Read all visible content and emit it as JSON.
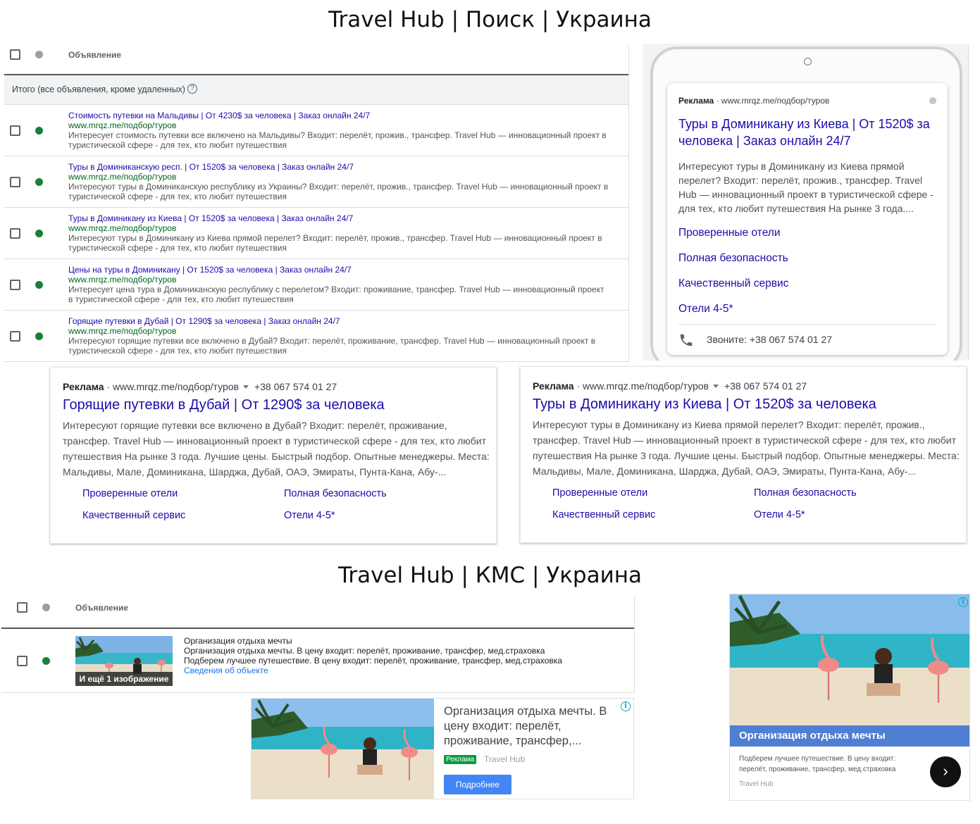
{
  "search_title": "Travel Hub | Поиск | Украина",
  "kms_title": "Travel Hub | КМС | Украина",
  "search_table": {
    "column_header": "Объявление",
    "total_label": "Итого (все объявления, кроме удаленных)",
    "help_glyph": "?",
    "rows": [
      {
        "headline": "Стоимость путевки на Мальдивы | От 4230$ за человека | Заказ онлайн 24/7",
        "url": "www.mrqz.me/подбор/туров",
        "description": "Интересует стоимость путевки все включено на Мальдивы? Входит: перелёт, прожив., трансфер. Travel Hub — инновационный проект в туристической сфере - для тех, кто любит путешествия"
      },
      {
        "headline": "Туры в Доминиканскую респ. | От 1520$ за человека | Заказ онлайн 24/7",
        "url": "www.mrqz.me/подбор/туров",
        "description": "Интересуют туры в Доминиканскую республику из Украины? Входит: перелёт, прожив., трансфер. Travel Hub — инновационный проект в туристической сфере - для тех, кто любит путешествия"
      },
      {
        "headline": "Туры в Доминикану из Киева | От 1520$ за человека | Заказ онлайн 24/7",
        "url": "www.mrqz.me/подбор/туров",
        "description": "Интересуют туры в Доминикану из Киева прямой перелет? Входит: перелёт, прожив., трансфер. Travel Hub — инновационный проект в туристической сфере - для тех, кто любит путешествия"
      },
      {
        "headline": "Цены на туры в Доминикану | От 1520$ за человека | Заказ онлайн 24/7",
        "url": "www.mrqz.me/подбор/туров",
        "description": "Интересует цена тура в Доминиканскую республику с перелетом? Входит: проживание, трансфер. Travel Hub — инновационный проект в туристической сфере - для тех, кто любит путешествия"
      },
      {
        "headline": "Горящие путевки в Дубай | От 1290$ за человека | Заказ онлайн 24/7",
        "url": "www.mrqz.me/подбор/туров",
        "description": "Интересуют горящие путевки все включено в Дубай? Входит: перелёт, проживание, трансфер. Travel Hub — инновационный проект в туристической сфере - для тех, кто любит путешествия"
      }
    ]
  },
  "mobile_ad": {
    "ad_label": "Реклама",
    "url": "www.mrqz.me/подбор/туров",
    "headline": "Туры в Доминикану из Киева | От 1520$ за человека | Заказ онлайн 24/7",
    "description": "Интересуют туры в Доминикану из Киева прямой перелет? Входит: перелёт, прожив., трансфер. Travel Hub — инновационный проект в туристической сфере - для тех, кто любит путешествия На рынке 3 года....",
    "sitelinks": [
      "Проверенные отели",
      "Полная безопасность",
      "Качественный сервис",
      "Отели 4-5*"
    ],
    "call_text": "Звоните: +38 067 574 01 27",
    "phone_icon": "phone-icon"
  },
  "desktop_ads": [
    {
      "ad_label": "Реклама",
      "url": "www.mrqz.me/подбор/туров",
      "phone": "+38 067 574 01 27",
      "headline": "Горящие путевки в Дубай | От 1290$ за человека",
      "description": "Интересуют горящие путевки все включено в Дубай? Входит: перелёт, проживание, трансфер. Travel Hub — инновационный проект в туристической сфере - для тех, кто любит путешествия На рынке 3 года. Лучшие цены. Быстрый подбор. Опытные менеджеры. Места: Мальдивы, Мале, Доминикана, Шарджа, Дубай, ОАЭ, Эмираты, Пунта-Кана, Абу-...",
      "sitelinks": [
        "Проверенные отели",
        "Полная безопасность",
        "Качественный сервис",
        "Отели 4-5*"
      ]
    },
    {
      "ad_label": "Реклама",
      "url": "www.mrqz.me/подбор/туров",
      "phone": "+38 067 574 01 27",
      "headline": "Туры в Доминикану из Киева | От 1520$ за человека",
      "description": "Интересуют туры в Доминикану из Киева прямой перелет? Входит: перелёт, прожив., трансфер. Travel Hub — инновационный проект в туристической сфере - для тех, кто любит путешествия На рынке 3 года. Лучшие цены. Быстрый подбор. Опытные менеджеры. Места: Мальдивы, Мале, Доминикана, Шарджа, Дубай, ОАЭ, Эмираты, Пунта-Кана, Абу-...",
      "sitelinks": [
        "Проверенные отели",
        "Полная безопасность",
        "Качественный сервис",
        "Отели 4-5*"
      ]
    }
  ],
  "kms_table": {
    "column_header": "Объявление",
    "row": {
      "image_overlay": "И ещё 1 изображение",
      "line1": "Организация отдыха мечты",
      "line2": "Организация отдыха мечты. В цену входит: перелёт, проживание, трансфер, мед.страховка",
      "line3": "Подберем лучшее путешествие. В цену входит: перелёт, проживание, трансфер, мед.страховка",
      "link": "Сведения об объекте"
    }
  },
  "banner_small": {
    "text": "Организация отдыха мечты. В цену входит: перелёт, проживание, трансфер,...",
    "ad_badge": "Реклама",
    "brand": "Travel Hub",
    "button": "Подробнее",
    "info_glyph": "i"
  },
  "banner_large": {
    "headline": "Организация отдыха мечты",
    "description": "Подберем лучшее путешествие. В цену входит: перелёт, проживание, трансфер, мед.страховка",
    "brand": "Travel Hub",
    "next_glyph": "›",
    "info_glyph": "i"
  },
  "colors": {
    "ad_link": "#1a0dab",
    "ad_url": "#006621",
    "status_active": "#188038",
    "status_neutral": "#9e9e9e",
    "banner_button": "#4285f4",
    "banner_bar": "#4f7ed3"
  }
}
